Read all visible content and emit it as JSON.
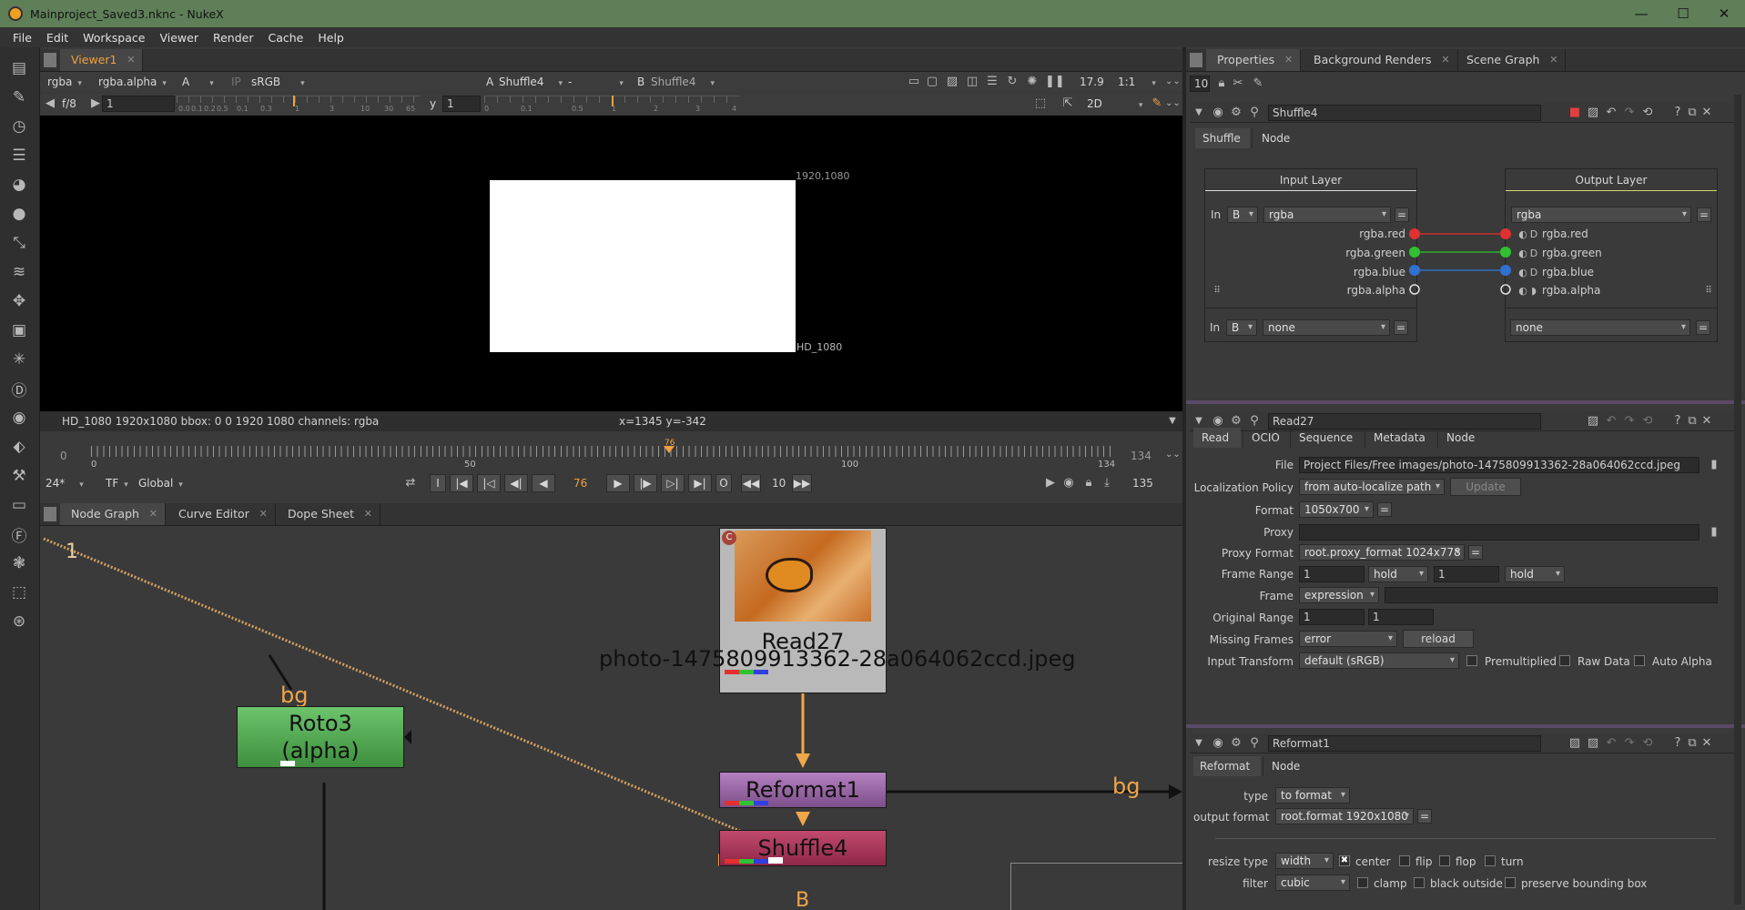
{
  "window": {
    "title": "Mainproject_Saved3.nknc - NukeX",
    "minimize": "—",
    "maximize": "☐",
    "close": "✕"
  },
  "menu": [
    "File",
    "Edit",
    "Workspace",
    "Viewer",
    "Render",
    "Cache",
    "Help"
  ],
  "viewer": {
    "tab": "Viewer1",
    "channels": "rgba",
    "alpha_channel": "rgba.alpha",
    "a_input_letter": "A",
    "ip": "IP",
    "colorspace": "sRGB",
    "a_label": "A",
    "a_node": "Shuffle4",
    "composite": "-",
    "b_label": "B",
    "b_node": "Shuffle4",
    "zoom": "17.9",
    "ratio": "1:1",
    "fstop": "f/8",
    "gain": "1",
    "gain_ticks": [
      "0.0",
      "0.1",
      "0.2",
      "0.5",
      "0.1",
      "0.3",
      "1",
      "3",
      "10",
      "30",
      "65"
    ],
    "y_label": "y",
    "gamma": "1",
    "gamma_ticks": [
      "0",
      "0.1",
      "0.5",
      "1",
      "2",
      "3",
      "4"
    ],
    "view_mode": "2D",
    "format_corner": "1920,1080",
    "format_name": "HD_1080",
    "info": "HD_1080 1920x1080  bbox: 0 0 1920 1080 channels: rgba",
    "coords": "x=1345 y=-342"
  },
  "timeline": {
    "start": "0",
    "end": "134",
    "current_marker": "76",
    "ticks": [
      "0",
      "50",
      "100",
      "134"
    ],
    "fps": "24*",
    "tf": "TF",
    "scope": "Global",
    "current_frame": "76",
    "step": "10",
    "end_frame": "135",
    "current_frame_fraction": 0.567
  },
  "nodegraph": {
    "tabs": [
      "Node Graph",
      "Curve Editor",
      "Dope Sheet"
    ],
    "nodes": {
      "read27_label": "Read27",
      "read27_file": "photo-1475809913362-28a064062ccd.jpeg",
      "read27_badge": "C",
      "roto3_label1": "Roto3",
      "roto3_label2": "(alpha)",
      "reformat1_label": "Reformat1",
      "shuffle4_label": "Shuffle4"
    },
    "labels": {
      "bg_left": "bg",
      "bg_right": "bg",
      "b_input": "B",
      "viewer_input": "1"
    },
    "colors": {
      "read": "#b9b9b9",
      "roto": "#4aa04a",
      "reformat": "#9b62a8",
      "shuffle": "#9b2d4e",
      "pipe_orange": "#f0a64a"
    }
  },
  "properties": {
    "tabs": [
      "Properties",
      "Background Renders",
      "Scene Graph"
    ],
    "max_panels": "10",
    "shuffle": {
      "name": "Shuffle4",
      "tabs": [
        "Shuffle",
        "Node"
      ],
      "input_layer": "Input Layer",
      "output_layer": "Output Layer",
      "in_label": "In",
      "in_input": "B",
      "in_layer": "rgba",
      "out_layer": "rgba",
      "eq": "=",
      "in_channels": [
        "rgba.red",
        "rgba.green",
        "rgba.blue",
        "rgba.alpha"
      ],
      "out_channels": [
        "rgba.red",
        "rgba.green",
        "rgba.blue",
        "rgba.alpha"
      ],
      "in2_label": "In",
      "in2_input": "B",
      "in2_layer": "none",
      "out2_layer": "none"
    },
    "read": {
      "name": "Read27",
      "tabs": [
        "Read",
        "OCIO",
        "Sequence",
        "Metadata",
        "Node"
      ],
      "file_label": "File",
      "file": "Project Files/Free images/photo-1475809913362-28a064062ccd.jpeg",
      "localization_label": "Localization Policy",
      "localization": "from auto-localize path",
      "update": "Update",
      "format_label": "Format",
      "format": "1050x700",
      "proxy_label": "Proxy",
      "proxy_format_label": "Proxy Format",
      "proxy_format": "root.proxy_format 1024x778",
      "frame_range_label": "Frame Range",
      "frame_range_start": "1",
      "frame_range_before": "hold",
      "frame_range_end": "1",
      "frame_range_after": "hold",
      "frame_label": "Frame",
      "frame_mode": "expression",
      "original_range_label": "Original Range",
      "original_start": "1",
      "original_end": "1",
      "missing_frames_label": "Missing Frames",
      "missing_frames": "error",
      "reload": "reload",
      "input_transform_label": "Input Transform",
      "input_transform": "default (sRGB)",
      "premultiplied": "Premultiplied",
      "raw_data": "Raw Data",
      "auto_alpha": "Auto Alpha"
    },
    "reformat": {
      "name": "Reformat1",
      "tabs": [
        "Reformat",
        "Node"
      ],
      "type_label": "type",
      "type": "to format",
      "output_format_label": "output format",
      "output_format": "root.format 1920x1080",
      "resize_type_label": "resize type",
      "resize_type": "width",
      "center": "center",
      "flip": "flip",
      "flop": "flop",
      "turn": "turn",
      "filter_label": "filter",
      "filter": "cubic",
      "clamp": "clamp",
      "black_outside": "black outside",
      "preserve_bbox": "preserve bounding box"
    }
  }
}
